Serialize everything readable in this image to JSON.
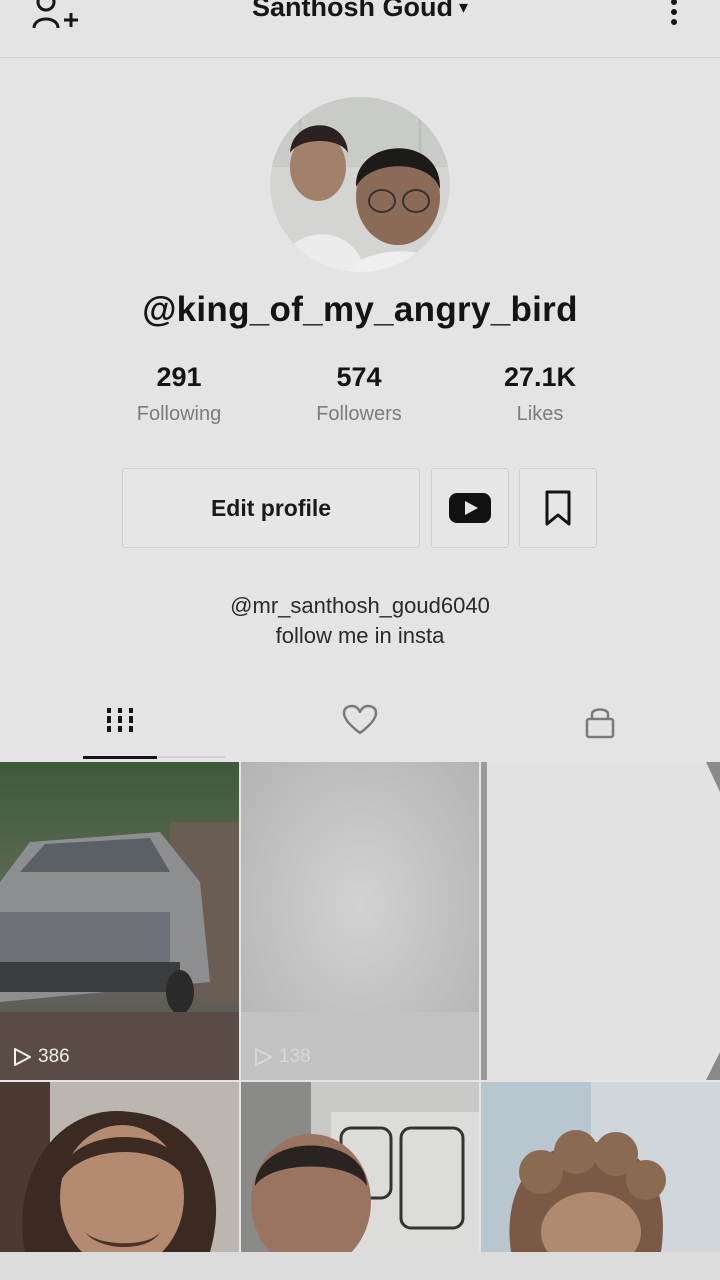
{
  "header": {
    "title": "Santhosh Goud",
    "caret": "▾",
    "add_user_icon": "person-add-icon",
    "more_icon": "vertical-dots-icon"
  },
  "profile": {
    "username": "@king_of_my_angry_bird",
    "stats": [
      {
        "value": "291",
        "label": "Following"
      },
      {
        "value": "574",
        "label": "Followers"
      },
      {
        "value": "27.1K",
        "label": "Likes"
      }
    ],
    "edit_button": "Edit profile",
    "youtube_icon": "youtube-icon",
    "bookmark_icon": "bookmark-icon",
    "bio_lines": [
      "@mr_santhosh_goud6040",
      "follow me in insta"
    ]
  },
  "tabs": [
    {
      "name": "videos",
      "icon": "grid-icon",
      "active": true
    },
    {
      "name": "liked",
      "icon": "heart-icon",
      "active": false
    },
    {
      "name": "private",
      "icon": "lock-icon",
      "active": false
    }
  ],
  "videos": [
    {
      "views": "386"
    },
    {
      "views": "138"
    },
    {
      "views": ""
    },
    {
      "views": ""
    },
    {
      "views": ""
    },
    {
      "views": ""
    }
  ],
  "colors": {
    "background": "#e4e4e4",
    "text": "#141414",
    "muted": "#7c7c7c",
    "youtube": "#111111"
  }
}
